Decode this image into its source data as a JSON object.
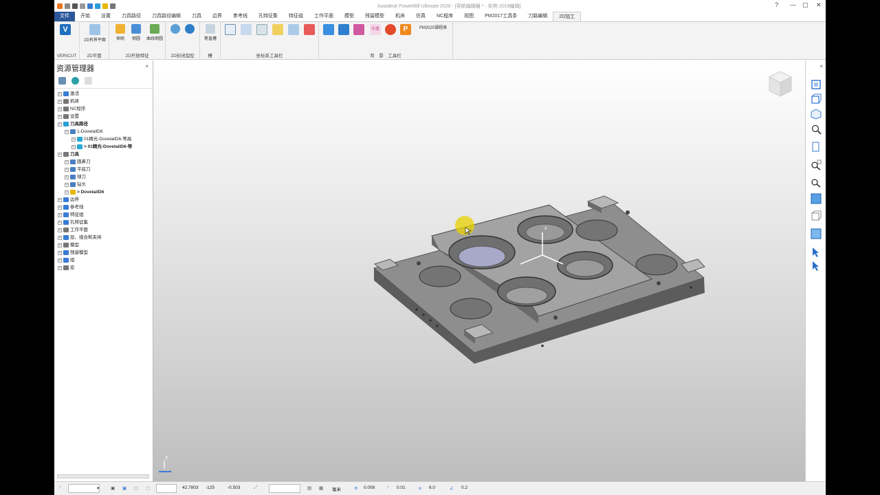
{
  "window": {
    "title": "Autodesk PowerMill Ultimate 2020 - [导航编辑器 * - 实例-2019编辑]"
  },
  "tabs": [
    "文件",
    "开始",
    "设置",
    "刀具路径",
    "刀具路径编辑",
    "刀具",
    "边界",
    "参考线",
    "孔特征集",
    "特征组",
    "工作平面",
    "模型",
    "残留模型",
    "机床",
    "仿真",
    "NC程序",
    "视图",
    "PM2017工具条",
    "刀路编辑",
    "2D加工"
  ],
  "active_tab": "2D加工",
  "ribbon": {
    "groups": [
      {
        "label": "VERICUT",
        "buttons": [
          ""
        ]
      },
      {
        "label": "2D平面",
        "buttons": [
          "2D有界平面"
        ]
      },
      {
        "label": "2D开放特征",
        "buttons": [
          "探刷",
          "倒圆",
          "曲线倒圆"
        ]
      },
      {
        "label": "2D封闭型腔",
        "buttons": [
          "",
          ""
        ]
      },
      {
        "label": "槽",
        "buttons": [
          "笔直槽"
        ]
      },
      {
        "label": "坐标系工具栏",
        "buttons": [
          "",
          "",
          "",
          "",
          "",
          ""
        ]
      },
      {
        "label": "背　景　工具栏",
        "buttons": [
          "",
          "",
          "",
          "千库",
          "",
          ""
        ]
      },
      {
        "label": "",
        "buttons": [
          "PM2020课程表"
        ]
      }
    ]
  },
  "explorer": {
    "title": "资源管理器",
    "tree": [
      {
        "label": "激活",
        "level": 0,
        "bold": false,
        "color": "#3a7bd5"
      },
      {
        "label": "机床",
        "level": 0,
        "bold": false,
        "color": "#777"
      },
      {
        "label": "NC程序",
        "level": 0,
        "bold": false,
        "color": "#777"
      },
      {
        "label": "设置",
        "level": 0,
        "bold": false,
        "color": "#777"
      },
      {
        "label": "刀具路径",
        "level": 0,
        "bold": true,
        "color": "#2a9fd6"
      },
      {
        "label": "1-DovetailD6",
        "level": 1,
        "bold": false,
        "color": "#4a7fc1"
      },
      {
        "label": "01精光-DovetailD6-等高",
        "level": 2,
        "bold": false,
        "color": "#29a8d6"
      },
      {
        "label": "> 01精光-DovetailD6-等",
        "level": 2,
        "bold": true,
        "color": "#29a8d6"
      },
      {
        "label": "刀具",
        "level": 0,
        "bold": true,
        "color": "#777"
      },
      {
        "label": "圆鼻刀",
        "level": 1,
        "bold": false,
        "color": "#4a7fc1"
      },
      {
        "label": "平底刀",
        "level": 1,
        "bold": false,
        "color": "#4a7fc1"
      },
      {
        "label": "球刀",
        "level": 1,
        "bold": false,
        "color": "#4a7fc1"
      },
      {
        "label": "钻头",
        "level": 1,
        "bold": false,
        "color": "#4a7fc1"
      },
      {
        "label": "> DovetailD6",
        "level": 1,
        "bold": true,
        "color": "#e6b800"
      },
      {
        "label": "边界",
        "level": 0,
        "bold": false,
        "color": "#3a7bd5"
      },
      {
        "label": "参考线",
        "level": 0,
        "bold": false,
        "color": "#3a7bd5"
      },
      {
        "label": "特征组",
        "level": 0,
        "bold": false,
        "color": "#3a7bd5"
      },
      {
        "label": "孔特征集",
        "level": 0,
        "bold": false,
        "color": "#3a7bd5"
      },
      {
        "label": "工作平面",
        "level": 0,
        "bold": false,
        "color": "#777"
      },
      {
        "label": "层、组合和夹持",
        "level": 0,
        "bold": false,
        "color": "#3a7bd5"
      },
      {
        "label": "模型",
        "level": 0,
        "bold": false,
        "color": "#777"
      },
      {
        "label": "残留模型",
        "level": 0,
        "bold": false,
        "color": "#3a7bd5"
      },
      {
        "label": "组",
        "level": 0,
        "bold": false,
        "color": "#3a7bd5"
      },
      {
        "label": "宏",
        "level": 0,
        "bold": false,
        "color": "#777"
      }
    ]
  },
  "viewport": {
    "axis_label": "Z",
    "triad_label": "z"
  },
  "status": {
    "coord_x": "42.7803",
    "coord_y": "-125",
    "coord_z": "-0.503",
    "units": "毫米",
    "tolerance": "0.008",
    "thickness": "0.01",
    "diameter": "6.0",
    "step": "0.2"
  }
}
